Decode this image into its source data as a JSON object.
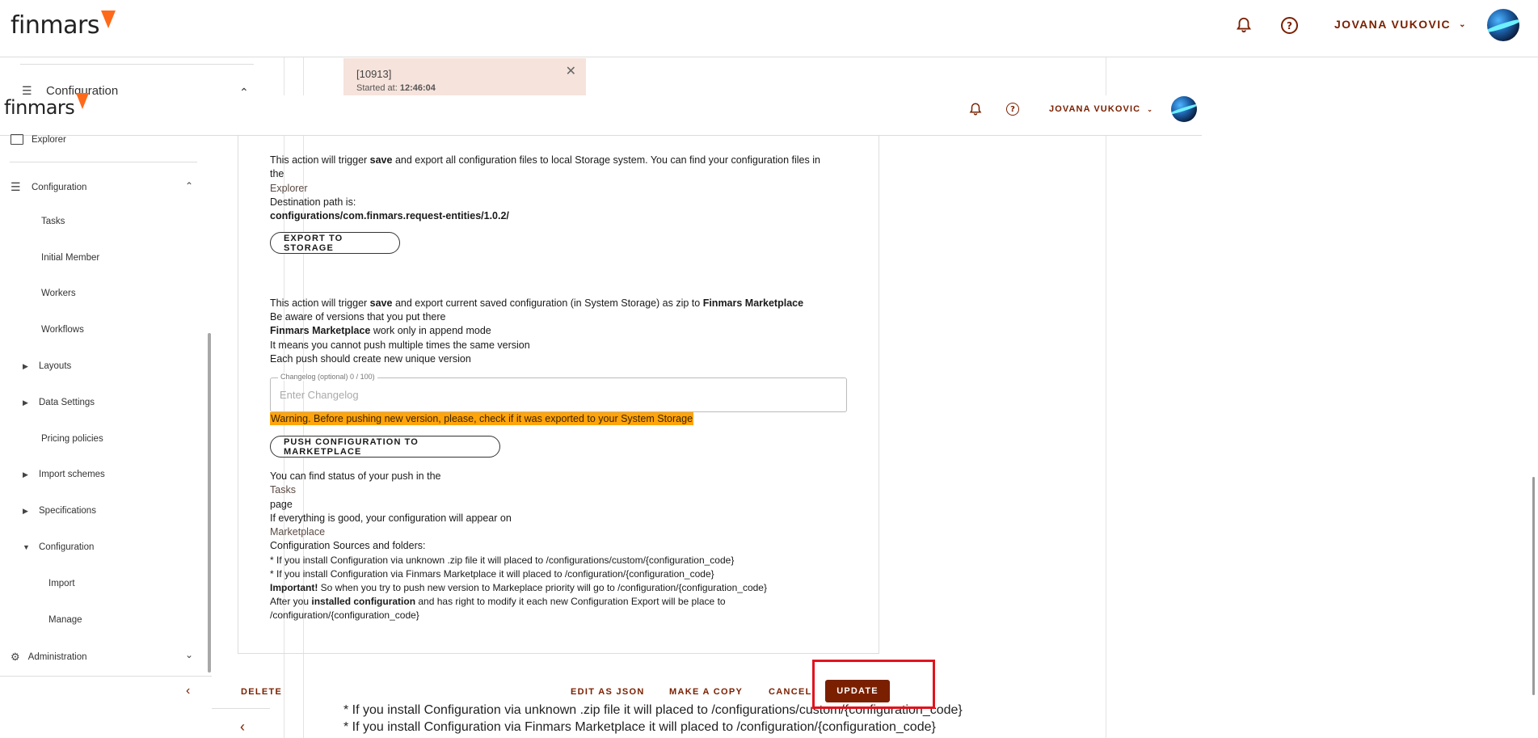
{
  "outer": {
    "logo_text": "finmars",
    "user_name": "JOVANA VUKOVIC",
    "sidebar_section": "Configuration",
    "toast": {
      "title": "[10913]",
      "started_label": "Started at:",
      "started_time": "12:46:04"
    },
    "footer_lines": [
      "* If you install Configuration via unknown .zip file it will placed to /configurations/custom/{configuration_code}",
      "* If you install Configuration via Finmars Marketplace it will placed to /configuration/{configuration_code}"
    ]
  },
  "header": {
    "logo_text": "finmars",
    "user_name": "JOVANA VUKOVIC"
  },
  "sidebar": {
    "explorer": "Explorer",
    "configuration": "Configuration",
    "items": [
      "Tasks",
      "Initial Member",
      "Workers",
      "Workflows",
      "Layouts",
      "Data Settings",
      "Pricing policies",
      "Import schemes",
      "Specifications",
      "Configuration",
      "Import",
      "Manage"
    ],
    "administration": "Administration"
  },
  "export": {
    "line1_a": "This action will trigger ",
    "line1_b": "save",
    "line1_c": " and export all configuration files to local Storage system. You can find your configuration files in",
    "line2": "the",
    "explorer_link": "Explorer",
    "dest_label": "Destination path is:",
    "dest_path": "configurations/com.finmars.request-entities/1.0.2/",
    "button": "EXPORT TO STORAGE"
  },
  "push": {
    "line1_a": "This action will trigger ",
    "line1_b": "save",
    "line1_c": " and export current saved configuration (in System Storage) as zip to ",
    "line1_d": "Finmars Marketplace",
    "line2": "Be aware of versions that you put there",
    "line3_a": "Finmars Marketplace",
    "line3_b": " work only in append mode",
    "line4": "It means you cannot push multiple times the same version",
    "line5": "Each push should create new unique version",
    "changelog_label": "Changelog (optional) 0 / 100)",
    "changelog_placeholder": "Enter Changelog",
    "warning": "Warning. Before pushing new version, please, check if it was exported to your System Storage",
    "button": "PUSH CONFIGURATION TO MARKETPLACE"
  },
  "info": {
    "status_line": "You can find status of your push in the",
    "tasks_link": "Tasks",
    "page_word": "page",
    "good_line": "If everything is good, your configuration will appear on",
    "marketplace_link": "Marketplace",
    "sources_title": "Configuration Sources and folders:",
    "source1": "* If you install Configuration via unknown .zip file it will placed to /configurations/custom/{configuration_code}",
    "source2": "* If you install Configuration via Finmars Marketplace it will placed to /configuration/{configuration_code}",
    "important_a": "Important!",
    "important_b": " So when you try to push new version to Markeplace priority will go to /configuration/{configuration_code}",
    "after_a": "After you ",
    "after_b": "installed configuration",
    "after_c": " and has right to modify it each new Configuration Export will be place to",
    "after_path": "/configuration/{configuration_code}"
  },
  "actions": {
    "delete": "DELETE",
    "edit_json": "EDIT AS JSON",
    "copy": "MAKE A COPY",
    "cancel": "CANCEL",
    "update": "UPDATE"
  },
  "colors": {
    "brand": "#7a2000",
    "warning": "#ffa40b",
    "highlight": "#e0141e",
    "logo_accent": "#ff6a1a"
  }
}
